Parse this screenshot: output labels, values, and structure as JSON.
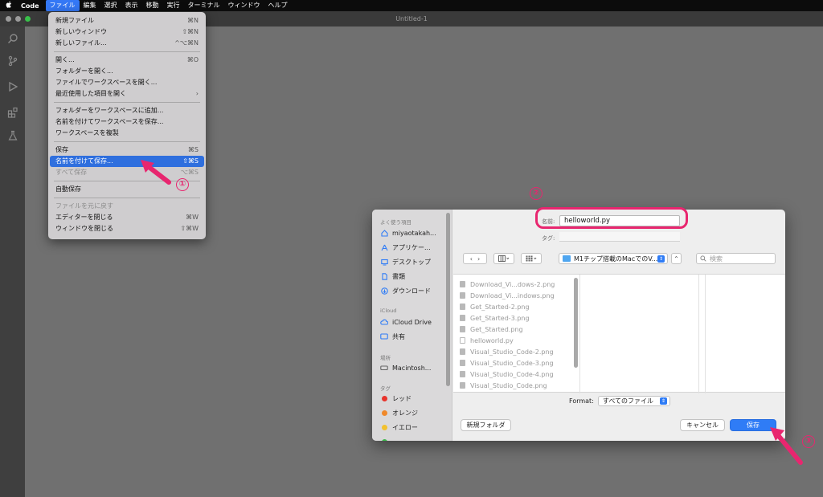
{
  "menubar": {
    "app_name": "Code",
    "menus": [
      "ファイル",
      "編集",
      "選択",
      "表示",
      "移動",
      "実行",
      "ターミナル",
      "ウィンドウ",
      "ヘルプ"
    ]
  },
  "window": {
    "title": "Untitled-1"
  },
  "file_menu": {
    "items": [
      {
        "label": "新規ファイル",
        "shortcut": "⌘N"
      },
      {
        "label": "新しいウィンドウ",
        "shortcut": "⇧⌘N"
      },
      {
        "label": "新しいファイル...",
        "shortcut": "^⌥⌘N"
      },
      {
        "label": "開く...",
        "shortcut": "⌘O"
      },
      {
        "label": "フォルダーを開く...",
        "shortcut": ""
      },
      {
        "label": "ファイルでワークスペースを開く...",
        "shortcut": ""
      },
      {
        "label": "最近使用した項目を開く",
        "shortcut": "›"
      },
      {
        "label": "フォルダーをワークスペースに追加...",
        "shortcut": ""
      },
      {
        "label": "名前を付けてワークスペースを保存...",
        "shortcut": ""
      },
      {
        "label": "ワークスペースを複製",
        "shortcut": ""
      },
      {
        "label": "保存",
        "shortcut": "⌘S"
      },
      {
        "label": "名前を付けて保存...",
        "shortcut": "⇧⌘S"
      },
      {
        "label": "すべて保存",
        "shortcut": "⌥⌘S"
      },
      {
        "label": "自動保存",
        "shortcut": ""
      },
      {
        "label": "ファイルを元に戻す",
        "shortcut": ""
      },
      {
        "label": "エディターを閉じる",
        "shortcut": "⌘W"
      },
      {
        "label": "ウィンドウを閉じる",
        "shortcut": "⇧⌘W"
      }
    ]
  },
  "save_dialog": {
    "sidebar": {
      "favorites_header": "よく使う項目",
      "favorites": [
        "miyaotakah...",
        "アプリケー...",
        "デスクトップ",
        "書類",
        "ダウンロード"
      ],
      "icloud_header": "iCloud",
      "icloud": [
        "iCloud Drive",
        "共有"
      ],
      "locations_header": "場所",
      "locations": [
        "Macintosh..."
      ],
      "tags_header": "タグ",
      "tags": [
        {
          "label": "レッド",
          "color": "#e8342c"
        },
        {
          "label": "オレンジ",
          "color": "#f0892a"
        },
        {
          "label": "イエロー",
          "color": "#f2c12e"
        }
      ]
    },
    "name_label": "名前:",
    "name_value": "helloworld.py",
    "tag_label": "タグ:",
    "location": "M1チップ搭載のMacでのV...",
    "search_placeholder": "検索",
    "files": [
      "Download_Vi...dows-2.png",
      "Download_Vi...indows.png",
      "Get_Started-2.png",
      "Get_Started-3.png",
      "Get_Started.png",
      "helloworld.py",
      "Visual_Studio_Code-2.png",
      "Visual_Studio_Code-3.png",
      "Visual_Studio_Code-4.png",
      "Visual_Studio_Code.png"
    ],
    "format_label": "Format:",
    "format_value": "すべてのファイル",
    "new_folder": "新規フォルダ",
    "cancel": "キャンセル",
    "save": "保存"
  },
  "annotations": {
    "step1": "①",
    "step2": "②",
    "step3": "③",
    "accent_color": "#e8266f"
  }
}
